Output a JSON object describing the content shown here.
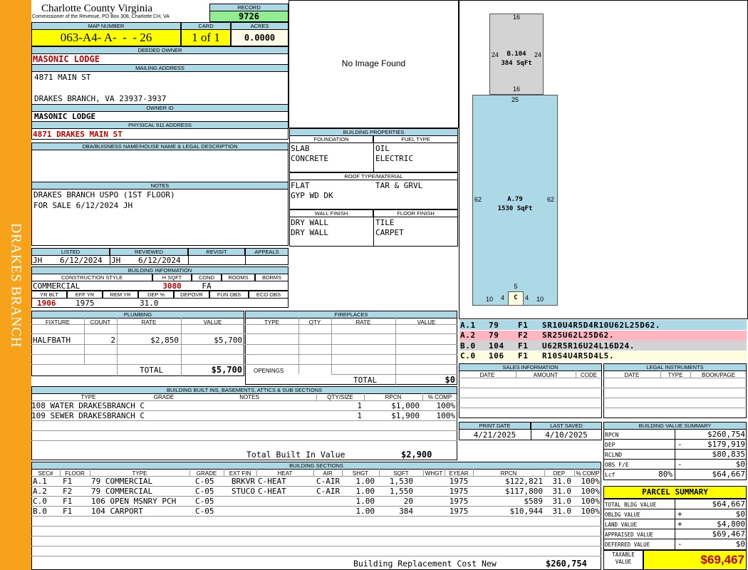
{
  "county": "Charlotte County Virginia",
  "commissioner": "Commissioner of the Revenue, PO Box 308, Charlotte CH, VA",
  "district": "DRAKES BRANCH",
  "record": {
    "label": "RECORD",
    "value": "9726"
  },
  "map": {
    "label": "MAP NUMBER",
    "value": "063-A4- A-  -  - 26",
    "card_label": "CARD",
    "card": "1 of 1",
    "acres_label": "ACRES",
    "acres": "0.0000"
  },
  "owner": {
    "label": "DEEDED OWNER",
    "value": "MASONIC LODGE"
  },
  "mailing": {
    "label": "MAILING ADDRESS",
    "line1": "4871 MAIN ST",
    "line2": "DRAKES BRANCH, VA 23937-3937"
  },
  "owner_id": {
    "label": "OWNER ID",
    "value": "MASONIC LODGE"
  },
  "physical": {
    "label": "PHYSICAL 911 ADDRESS",
    "value": "4871 DRAKES MAIN ST"
  },
  "dba": {
    "label": "DBA/BUISNESS NAME/HOUSE NAME & LEGAL DESCRIPTION"
  },
  "notes": {
    "label": "NOTES",
    "line1": "DRAKES BRANCH USPO (1ST FLOOR)",
    "line2": "FOR SALE 6/12/2024 JH"
  },
  "photo": {
    "text": "No Image Found"
  },
  "status": {
    "listed_label": "LISTED",
    "listed_by": "JH",
    "listed_date": "6/12/2024",
    "reviewed_label": "REVIEWED",
    "reviewed_by": "JH",
    "reviewed_date": "6/12/2024",
    "revisit_label": "REVISIT",
    "appeals_label": "APPEALS"
  },
  "bldg_info": {
    "label": "BUILDING INFORMATION",
    "style_label": "CONSTRUCTION STYLE",
    "style": "COMMERCIAL",
    "hsqft_label": "H SQFT",
    "hsqft": "3080",
    "cond_label": "COND",
    "cond": "FA",
    "rooms_label": "ROOMS",
    "bdrms_label": "BDRMS",
    "yrblt_label": "YR BLT",
    "yrblt": "1906",
    "effyr_label": "EFF YR",
    "effyr": "1975",
    "remyr_label": "REM YR",
    "dep_label": "DEP %",
    "dep": "31.0",
    "depovr_label": "DEPOVR",
    "funobs_label": "FUN OBS",
    "ecoobs_label": "ECO OBS"
  },
  "props": {
    "label": "BUILDING PROPERTIES",
    "foundation_label": "FOUNDATION",
    "foundation1": "SLAB",
    "foundation2": "CONCRETE",
    "fuel_label": "FUEL TYPE",
    "fuel1": "OIL",
    "fuel2": "ELECTRIC",
    "roof_label": "ROOF TYPE/MATERIAL",
    "roof1": "FLAT",
    "roof2": "TAR & GRVL",
    "roof3": "GYP WD DK",
    "wall_label": "WALL FINISH",
    "wall1": "DRY WALL",
    "wall2": "DRY WALL",
    "floor_label": "FLOOR FINISH",
    "floor1": "TILE",
    "floor2": "CARPET"
  },
  "plumbing": {
    "label": "PLUMBING",
    "h_fixture": "FIXTURE",
    "h_count": "COUNT",
    "h_rate": "RATE",
    "h_value": "VALUE",
    "fixture": "HALFBATH",
    "count": "2",
    "rate": "$2,850",
    "value": "$5,700",
    "total_label": "TOTAL",
    "total": "$5,700"
  },
  "fireplaces": {
    "label": "FIREPLACES",
    "h_type": "TYPE",
    "h_qty": "QTY",
    "h_rate": "RATE",
    "h_value": "VALUE",
    "openings_label": "OPENINGS",
    "total_label": "TOTAL",
    "total": "$0"
  },
  "builtins": {
    "label": "BUILDING BUILT INS, BASEMENTS, ATTICS & SUB SECTIONS",
    "h_type": "TYPE",
    "h_grade": "GRADE",
    "h_notes": "NOTES",
    "h_qty": "QTY/SIZE",
    "h_rpcn": "RPCN",
    "h_comp": "% COMP",
    "rows": [
      {
        "type": "108 WATER DRAKESBRANCH C",
        "qty": "1",
        "rpcn": "$1,000",
        "comp": "100%"
      },
      {
        "type": "109 SEWER DRAKESBRANCH C",
        "qty": "1",
        "rpcn": "$1,900",
        "comp": "100%"
      }
    ],
    "total_label": "Total Built In Value",
    "total": "$2,900"
  },
  "sections": {
    "label": "BUILDING SECTIONS",
    "headers": [
      "SEC#",
      "FLOOR",
      "TYPE",
      "GRADE",
      "EXT FIN",
      "HEAT",
      "AIR",
      "SHGT",
      "SQFT",
      "WHGT",
      "EYEAR",
      "RPCN",
      "DEP",
      "% COMP"
    ],
    "rows": [
      {
        "sec": "A.1",
        "floor": "F1",
        "type": "79 COMMERCIAL",
        "grade": "C-05",
        "ext": "BRKVR",
        "heat": "C-HEAT",
        "air": "C-AIR",
        "shgt": "1.00",
        "sqft": "1,530",
        "whgt": "",
        "eyear": "1975",
        "rpcn": "$122,821",
        "dep": "31.0",
        "comp": "100%"
      },
      {
        "sec": "A.2",
        "floor": "F2",
        "type": "79 COMMERCIAL",
        "grade": "C-05",
        "ext": "STUCO",
        "heat": "C-HEAT",
        "air": "C-AIR",
        "shgt": "1.00",
        "sqft": "1,550",
        "whgt": "",
        "eyear": "1975",
        "rpcn": "$117,800",
        "dep": "31.0",
        "comp": "100%"
      },
      {
        "sec": "C.0",
        "floor": "F1",
        "type": "106 OPEN MSNRY PCH",
        "grade": "C-05",
        "ext": "",
        "heat": "",
        "air": "",
        "shgt": "1.00",
        "sqft": "20",
        "whgt": "",
        "eyear": "1975",
        "rpcn": "$589",
        "dep": "31.0",
        "comp": "100%"
      },
      {
        "sec": "B.0",
        "floor": "F1",
        "type": "104 CARPORT",
        "grade": "C-05",
        "ext": "",
        "heat": "",
        "air": "",
        "shgt": "1.00",
        "sqft": "384",
        "whgt": "",
        "eyear": "1975",
        "rpcn": "$10,944",
        "dep": "31.0",
        "comp": "100%"
      }
    ],
    "total_label": "Building Replacement Cost New",
    "total": "$260,754"
  },
  "sketch": {
    "b_label": "B.104",
    "b_area": "384 SqFt",
    "b_top": "16",
    "b_left": "24",
    "b_right": "24",
    "b_bottom": "16",
    "a_label": "A.79",
    "a_area": "1530 SqFt",
    "a_top": "25",
    "a_left": "62",
    "a_right": "62",
    "c_label": "C",
    "c_top": "5",
    "c_l1": "10",
    "c_l2": "4",
    "c_r1": "4",
    "c_r2": "10",
    "colors": {
      "a": "#ADD8E6",
      "b": "#D3D3D3",
      "c": "#FFFDE0"
    }
  },
  "sketch_legend": [
    {
      "id": "A.1",
      "code": "79",
      "floor": "F1",
      "vec": "SR10U4R5D4R10U62L25D62.",
      "color": "#ADD8E6"
    },
    {
      "id": "A.2",
      "code": "79",
      "floor": "F2",
      "vec": "SR25U62L25D62.",
      "color": "#FFB6C1"
    },
    {
      "id": "B.0",
      "code": "104",
      "floor": "F1",
      "vec": "U62R5R16U24L16D24.",
      "color": "#D3D3D3"
    },
    {
      "id": "C.0",
      "code": "106",
      "floor": "F1",
      "vec": "R10S4U4R5D4L5.",
      "color": "#FFFDE0"
    }
  ],
  "sales": {
    "label": "SALES INFORMATION",
    "h_date": "DATE",
    "h_amount": "AMOUNT",
    "h_code": "CODE"
  },
  "legal": {
    "label": "LEGAL INSTRUMENTS",
    "h_date": "DATE",
    "h_type": "TYPE",
    "h_bookpage": "BOOK/PAGE"
  },
  "dates": {
    "print_label": "PRINT DATE",
    "print": "4/21/2025",
    "saved_label": "LAST SAVED",
    "saved": "4/10/2025"
  },
  "value_summary": {
    "label": "BUILDING VALUE SUMMARY",
    "rpcn_label": "RPCN",
    "rpcn": "$260,754",
    "dep_label": "DEP",
    "dep_sign": "-",
    "dep": "$179,919",
    "rclnd_label": "RCLND",
    "rclnd": "$80,835",
    "obs_label": "OBS F/E",
    "obs_sign": "-",
    "obs": "$0",
    "lcf_label": "Lcf",
    "lcf_pct": "80%",
    "lcf": "$64,667"
  },
  "parcel": {
    "label": "PARCEL SUMMARY",
    "tbv_label": "TOTAL BLDG VALUE",
    "tbv": "$64,667",
    "obldg_label": "OBLDG VALUE",
    "obldg_sign": "+",
    "obldg": "$0",
    "land_label": "LAND VALUE",
    "land_sign": "+",
    "land": "$4,800",
    "appr_label": "APPRAISED VALUE",
    "appr": "$69,467",
    "def_label": "DEFERRED VALUE",
    "def_sign": "-",
    "def": "$0",
    "taxable_label1": "TAXABLE",
    "taxable_label2": "VALUE",
    "taxable": "$69,467"
  }
}
